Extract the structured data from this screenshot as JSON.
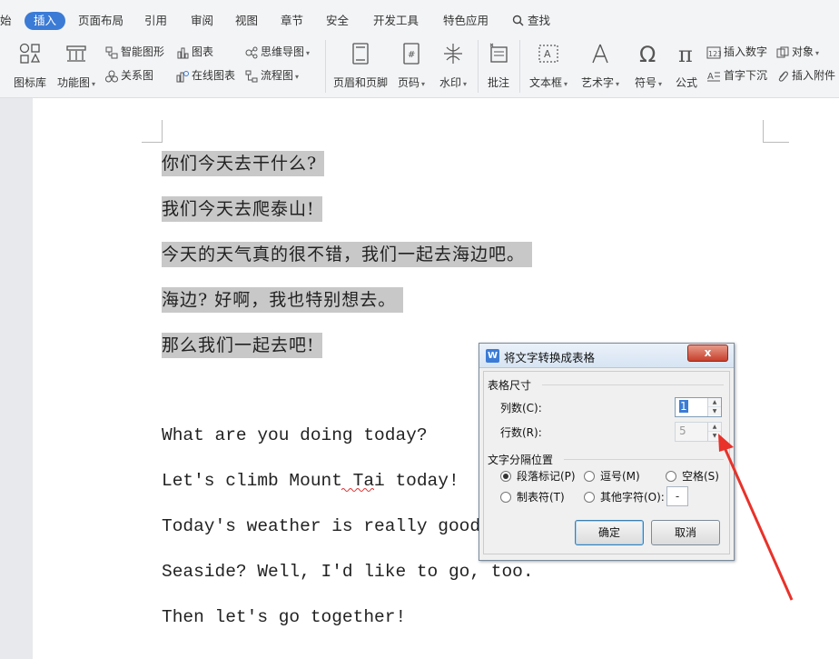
{
  "tabs": [
    "始",
    "插入",
    "页面布局",
    "引用",
    "审阅",
    "视图",
    "章节",
    "安全",
    "开发工具",
    "特色应用",
    "查找"
  ],
  "ribbon": {
    "icon_lib": "图标库",
    "func_chart": "功能图",
    "smart_art": "智能图形",
    "relation": "关系图",
    "chart": "图表",
    "online_chart": "在线图表",
    "mindmap": "思维导图",
    "flowchart": "流程图",
    "header_footer": "页眉和页脚",
    "page_num": "页码",
    "watermark": "水印",
    "comment": "批注",
    "textbox": "文本框",
    "wordart": "艺术字",
    "symbol": "符号",
    "formula": "公式",
    "insert_number": "插入数字",
    "object": "对象",
    "drop_cap": "首字下沉",
    "attachment": "插入附件"
  },
  "document": {
    "chinese_lines": [
      "你们今天去干什么?",
      "我们今天去爬泰山!",
      "今天的天气真的很不错，我们一起去海边吧。",
      "海边? 好啊，我也特别想去。",
      "那么我们一起去吧!"
    ],
    "english_lines": [
      "What are you doing today?",
      "Let's climb Mount Tai today!",
      "Today's weather is really good. l",
      "Seaside? Well, I'd like to go, too.",
      "Then let's go together!"
    ]
  },
  "dialog": {
    "title": "将文字转换成表格",
    "size_group": "表格尺寸",
    "cols_label": "列数(C):",
    "cols_value": "1",
    "rows_label": "行数(R):",
    "rows_value": "5",
    "sep_group": "文字分隔位置",
    "opt_paragraph": "段落标记(P)",
    "opt_comma": "逗号(M)",
    "opt_space": "空格(S)",
    "opt_tab": "制表符(T)",
    "opt_other": "其他字符(O):",
    "other_value": "-",
    "ok": "确定",
    "cancel": "取消",
    "close_glyph": "x",
    "app_glyph": "W"
  },
  "colors": {
    "accent": "#3b7bd6",
    "selection": "#c8c8c8",
    "annotation_arrow": "#e8322a"
  }
}
